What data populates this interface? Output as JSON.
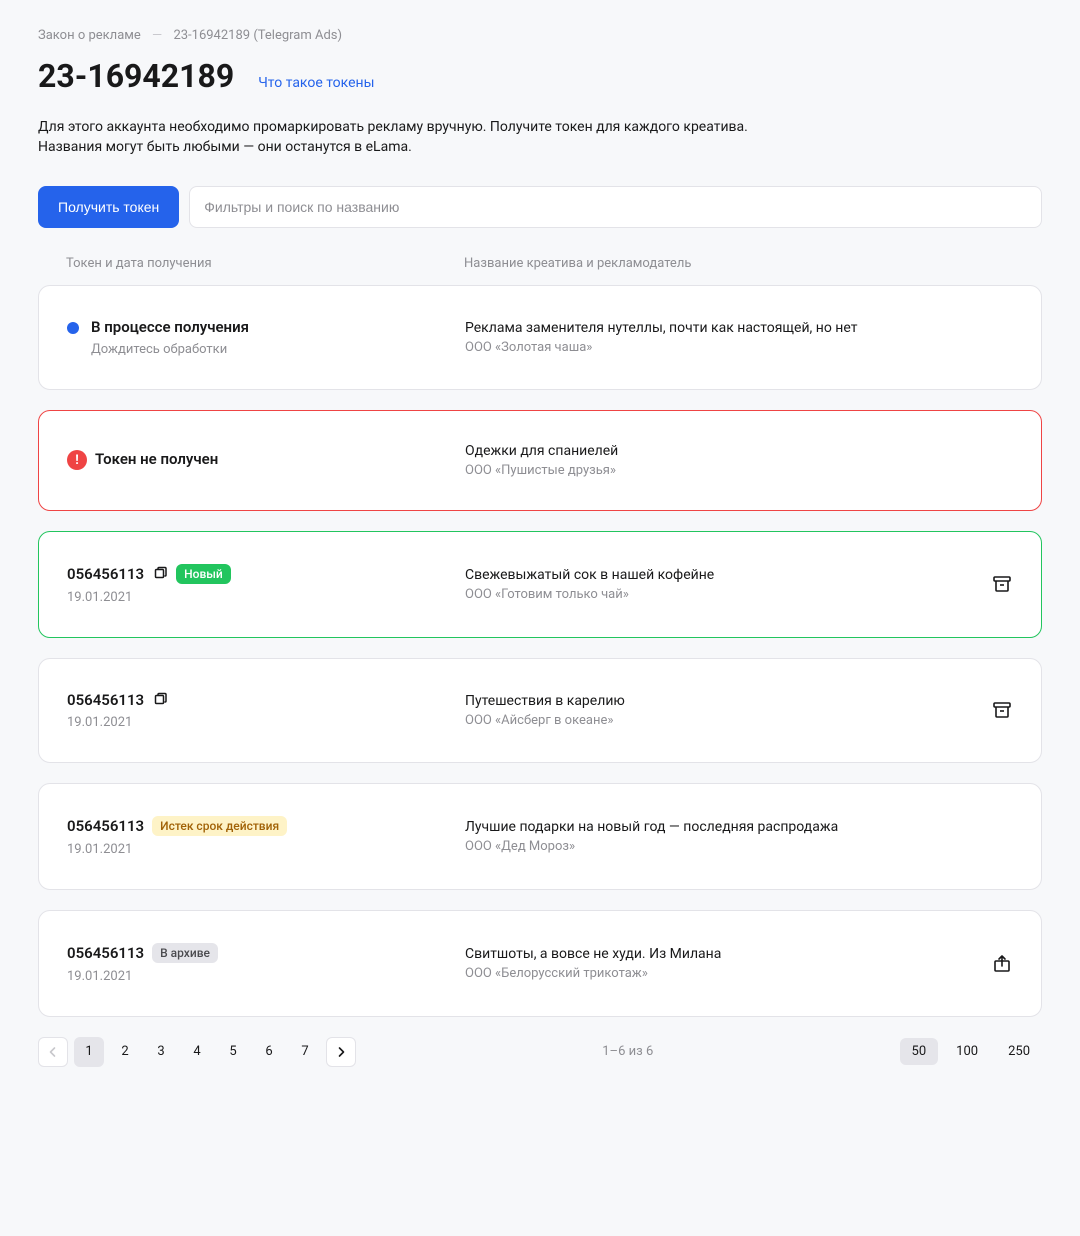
{
  "breadcrumb": {
    "root": "Закон о рекламе",
    "sep": "—",
    "current": "23-16942189 (Telegram Ads)"
  },
  "header": {
    "title": "23-16942189",
    "tokens_link": "Что такое токены"
  },
  "description": "Для этого аккаунта необходимо промаркировать рекламу вручную. Получите токен для каждого креатива.\nНазвания могут быть любыми — они останутся в eLama.",
  "controls": {
    "primary_button": "Получить токен",
    "search_placeholder": "Фильтры и поиск по названию"
  },
  "table": {
    "th_token": "Токен и дата получения",
    "th_creative": "Название креатива и рекламодатель"
  },
  "rows": [
    {
      "kind": "pending",
      "title": "В процессе получения",
      "sub": "Дождитесь обработки",
      "creative": "Реклама заменителя нутеллы, почти как настоящей, но нет",
      "advertiser": "ООО «Золотая чаша»"
    },
    {
      "kind": "error",
      "title": "Токен не получен",
      "creative": "Одежки для спаниелей",
      "advertiser": "ООО «Пушистые друзья»"
    },
    {
      "kind": "success",
      "token": "056456113",
      "date": "19.01.2021",
      "badge": "Новый",
      "creative": "Свежевыжатый сок в нашей кофейне",
      "advertiser": "ООО «Готовим только чай»",
      "action": "archive"
    },
    {
      "kind": "normal",
      "token": "056456113",
      "date": "19.01.2021",
      "creative": "Путешествия в карелию",
      "advertiser": "ООО «Айсберг в океане»",
      "action": "archive"
    },
    {
      "kind": "expired",
      "token": "056456113",
      "date": "19.01.2021",
      "badge": "Истек срок действия",
      "creative": "Лучшие подарки на новый год — последняя распродажа",
      "advertiser": "ООО «Дед Мороз»"
    },
    {
      "kind": "archived",
      "token": "056456113",
      "date": "19.01.2021",
      "badge": "В архиве",
      "creative": "Свитшоты, а вовсе не худи. Из Милана",
      "advertiser": "ООО «Белорусский трикотаж»",
      "action": "unarchive"
    }
  ],
  "pagination": {
    "pages": [
      "1",
      "2",
      "3",
      "4",
      "5",
      "6",
      "7"
    ],
    "active_page": "1",
    "info": "1–6 из 6",
    "sizes": [
      "50",
      "100",
      "250"
    ],
    "active_size": "50"
  }
}
